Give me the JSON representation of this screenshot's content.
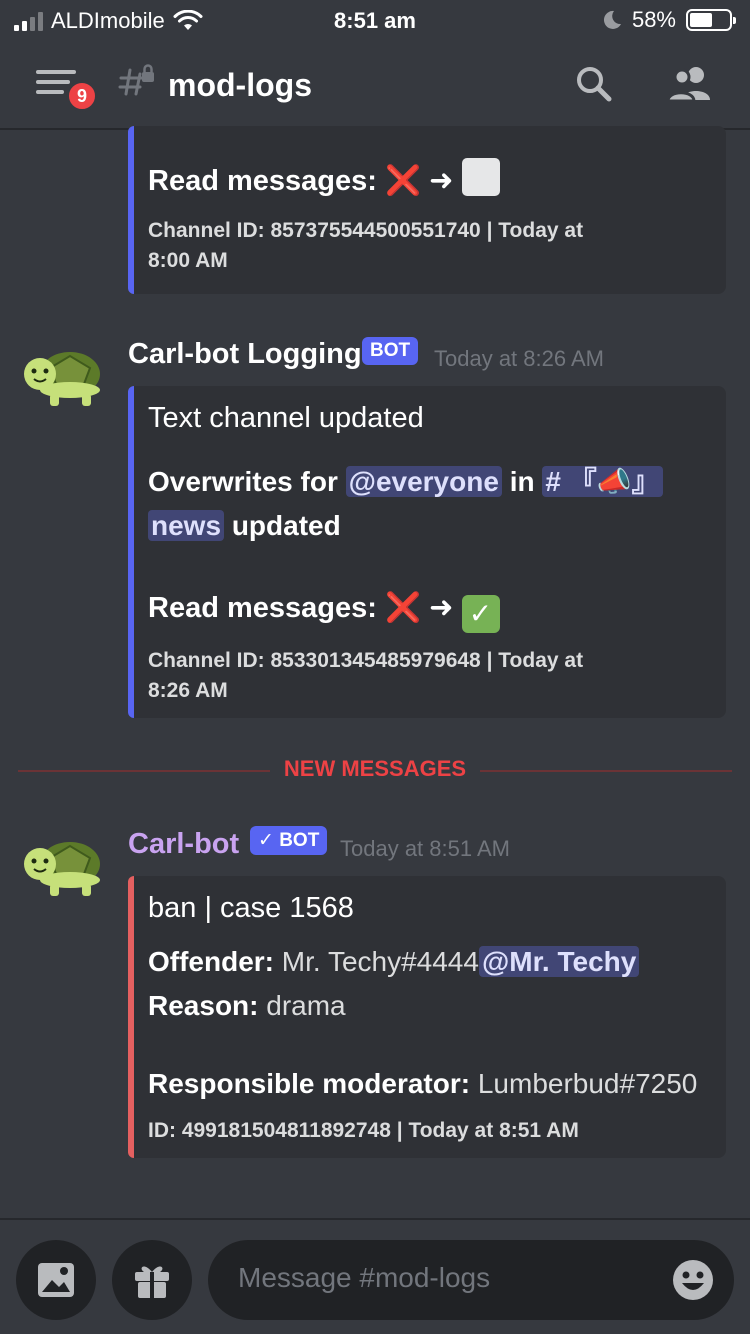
{
  "status_bar": {
    "carrier": "ALDImobile",
    "time": "8:51 am",
    "battery_percent": "58%",
    "battery_level": 0.58
  },
  "header": {
    "notification_count": "9",
    "channel_name": "mod-logs",
    "icons": [
      "menu-icon",
      "locked-hash-icon",
      "search-icon",
      "members-icon"
    ]
  },
  "messages": [
    {
      "embed": {
        "read_label": "Read messages:",
        "channel_footer_line1": "Channel ID: 857375544500551740 | Today at",
        "channel_footer_line2": "8:00 AM"
      }
    },
    {
      "author": "Carl-bot Logging",
      "bot_tag": "BOT",
      "timestamp": "Today at 8:26 AM",
      "embed": {
        "title": "Text channel updated",
        "overwrites_prefix": "Overwrites for",
        "mention_everyone": "@everyone",
        "in_word": "in",
        "channel_mention_part1": "# 『📣』",
        "channel_mention_part2": "news",
        "updated_word": "updated",
        "read_label": "Read messages:",
        "footer_line1": "Channel ID: 853301345485979648 | Today at",
        "footer_line2": "8:26 AM"
      }
    },
    {
      "author": "Carl-bot",
      "author_color": "#c9a3f0",
      "bot_tag": "✓ BOT",
      "timestamp": "Today at 8:51 AM",
      "embed": {
        "title": "ban | case 1568",
        "offender_label": "Offender:",
        "offender_value": "Mr. Techy#4444",
        "offender_mention": "@Mr. Techy",
        "reason_label": "Reason:",
        "reason_value": "drama",
        "moderator_label": "Responsible moderator:",
        "moderator_value": "Lumberbud#7250",
        "footer": "ID: 499181504811892748 | Today at 8:51 AM"
      }
    }
  ],
  "divider_label": "NEW MESSAGES",
  "composer": {
    "placeholder": "Message #mod-logs",
    "icons": [
      "image-icon",
      "gift-icon",
      "emoji-icon"
    ]
  },
  "colors": {
    "background": "#36393f",
    "embed_bg": "#2f3136",
    "blurple": "#5865f2",
    "ban_red": "#e46060",
    "new_messages_red": "#ed4245"
  }
}
